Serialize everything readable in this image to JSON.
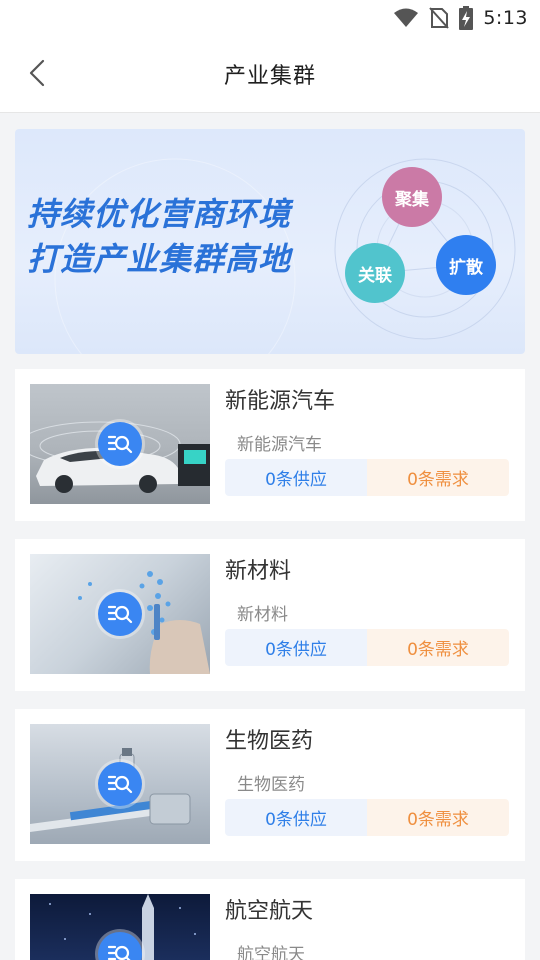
{
  "status_bar": {
    "time": "5:13",
    "icons": [
      "wifi-icon",
      "no-sim-icon",
      "battery-charging-icon"
    ]
  },
  "header": {
    "back_icon": "chevron-left-icon",
    "title": "产业集群"
  },
  "banner": {
    "line1": "持续优化营商环境",
    "line2": "打造产业集群高地",
    "bubble_pink": "聚集",
    "bubble_teal": "关联",
    "bubble_blue": "扩散"
  },
  "clusters": [
    {
      "title": "新能源汽车",
      "subtitle": "新能源汽车",
      "supply": "0条供应",
      "demand": "0条需求",
      "thumb_icon": "search-list-icon"
    },
    {
      "title": "新材料",
      "subtitle": "新材料",
      "supply": "0条供应",
      "demand": "0条需求",
      "thumb_icon": "search-list-icon"
    },
    {
      "title": "生物医药",
      "subtitle": "生物医药",
      "supply": "0条供应",
      "demand": "0条需求",
      "thumb_icon": "search-list-icon"
    },
    {
      "title": "航空航天",
      "subtitle": "航空航天",
      "supply": "",
      "demand": "",
      "thumb_icon": "search-list-icon"
    }
  ],
  "colors": {
    "accent_blue": "#2f7fe8",
    "accent_orange": "#ef8f3f",
    "banner_text": "#2a72d8"
  }
}
